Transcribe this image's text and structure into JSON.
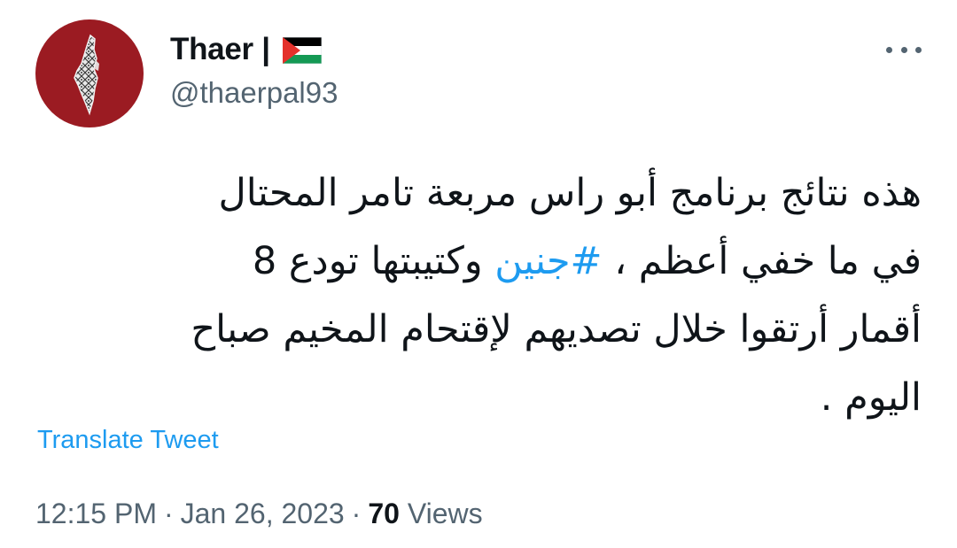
{
  "author": {
    "display_name": "Thaer |",
    "handle": "@thaerpal93",
    "flag_icon": "palestine-flag-icon",
    "avatar_icon": "palestine-map-keffiyeh-avatar"
  },
  "menu": {
    "more_icon": "more-horizontal-icon"
  },
  "tweet": {
    "lines": [
      {
        "text": "هذه نتائج برنامج أبو راس مربعة تامر المحتال"
      },
      {
        "before": "في ما خفي أعظم ، ",
        "hashtag": "#جنين",
        "after": " وكتيبتها تودع 8"
      },
      {
        "text": "أقمار  أرتقوا خلال تصديهم لإقتحام المخيم صباح"
      },
      {
        "text": "اليوم ."
      }
    ]
  },
  "translate_label": "Translate Tweet",
  "meta": {
    "time": "12:15 PM",
    "separator": "·",
    "date": "Jan 26, 2023",
    "views_count": "70",
    "views_label": "Views"
  },
  "colors": {
    "accent": "#1d9bf0",
    "secondary_text": "#536471",
    "primary_text": "#0f1419",
    "avatar_bg": "#9b1b22",
    "flag_black": "#000000",
    "flag_white": "#ffffff",
    "flag_green": "#149954",
    "flag_red": "#e4312b"
  }
}
